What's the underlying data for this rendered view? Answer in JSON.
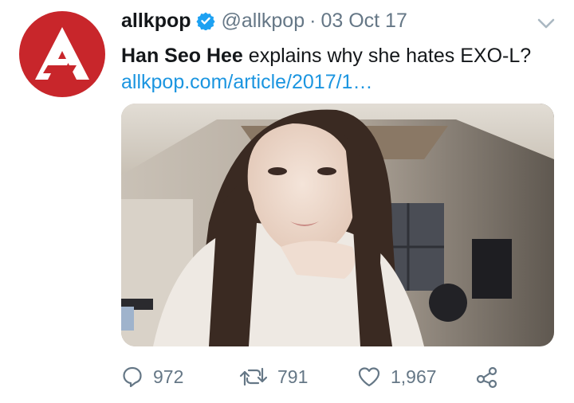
{
  "tweet": {
    "display_name": "allkpop",
    "handle": "@allkpop",
    "separator": "·",
    "date": "03 Oct 17",
    "text_bold": "Han Seo Hee",
    "text_rest": " explains why she hates EXO-L?",
    "link": "allkpop.com/article/2017/1…"
  },
  "stats": {
    "replies": "972",
    "retweets": "791",
    "likes": "1,967"
  },
  "icons": {
    "avatar": "allkpop-logo-icon",
    "verified": "verified-badge-icon",
    "menu": "chevron-down-icon",
    "reply": "reply-icon",
    "retweet": "retweet-icon",
    "like": "heart-icon",
    "share": "share-icon"
  },
  "colors": {
    "brand_red": "#c8262b",
    "link_blue": "#1b95e0",
    "muted_gray": "#657786",
    "text_dark": "#14171a"
  }
}
